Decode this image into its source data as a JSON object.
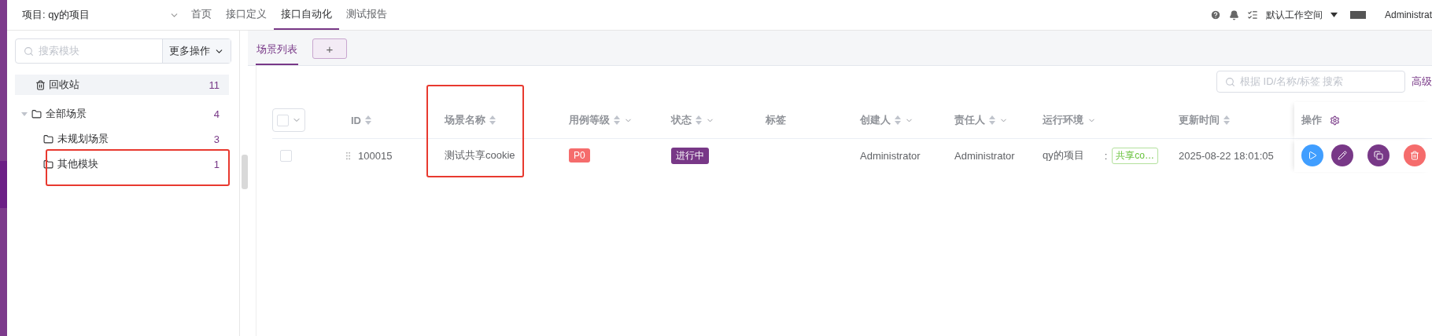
{
  "topbar": {
    "project": "项目: qy的项目",
    "nav": [
      {
        "label": "首页",
        "selected": false
      },
      {
        "label": "接口定义",
        "selected": false
      },
      {
        "label": "接口自动化",
        "selected": true
      },
      {
        "label": "测试报告",
        "selected": false
      }
    ],
    "workspace": "默认工作空间",
    "user": "Administrat"
  },
  "sidebar": {
    "search": {
      "placeholder": "搜索模块"
    },
    "more": "更多操作",
    "trash": {
      "label": "回收站",
      "count": "11"
    },
    "tree": [
      {
        "label": "全部场景",
        "count": "4",
        "expanded": true,
        "children": [
          {
            "label": "未规划场景",
            "count": "3",
            "highlighted": false
          },
          {
            "label": "其他模块",
            "count": "1",
            "highlighted": true
          }
        ]
      }
    ]
  },
  "tabs": [
    {
      "label": "场景列表",
      "selected": true
    }
  ],
  "add_tab": "+",
  "search": {
    "placeholder": "根据 ID/名称/标签 搜索"
  },
  "advanced": "高级",
  "header_checkbox": {
    "checked": false
  },
  "columns": [
    {
      "label": "ID",
      "sortable": true,
      "filterable": false,
      "highlighted": false
    },
    {
      "label": "场景名称",
      "sortable": true,
      "filterable": false,
      "highlighted": true
    },
    {
      "label": "用例等级",
      "sortable": true,
      "filterable": true,
      "highlighted": false
    },
    {
      "label": "状态",
      "sortable": true,
      "filterable": true,
      "highlighted": false
    },
    {
      "label": "标签",
      "sortable": false,
      "filterable": false,
      "highlighted": false
    },
    {
      "label": "创建人",
      "sortable": true,
      "filterable": true,
      "highlighted": false
    },
    {
      "label": "责任人",
      "sortable": true,
      "filterable": true,
      "highlighted": false
    },
    {
      "label": "运行环境",
      "sortable": false,
      "filterable": true,
      "highlighted": false
    },
    {
      "label": "更新时间",
      "sortable": true,
      "filterable": false,
      "highlighted": false
    }
  ],
  "ops_column": "操作",
  "rows": [
    {
      "checked": false,
      "id": "100015",
      "name": "测试共享cookie",
      "level": "P0",
      "status": "进行中",
      "creator": "Administrator",
      "owner": "Administrator",
      "env": "qy的项目",
      "env_separator": ":",
      "env_tag": "共享co…",
      "updated": "2025-08-22 18:01:05"
    }
  ]
}
